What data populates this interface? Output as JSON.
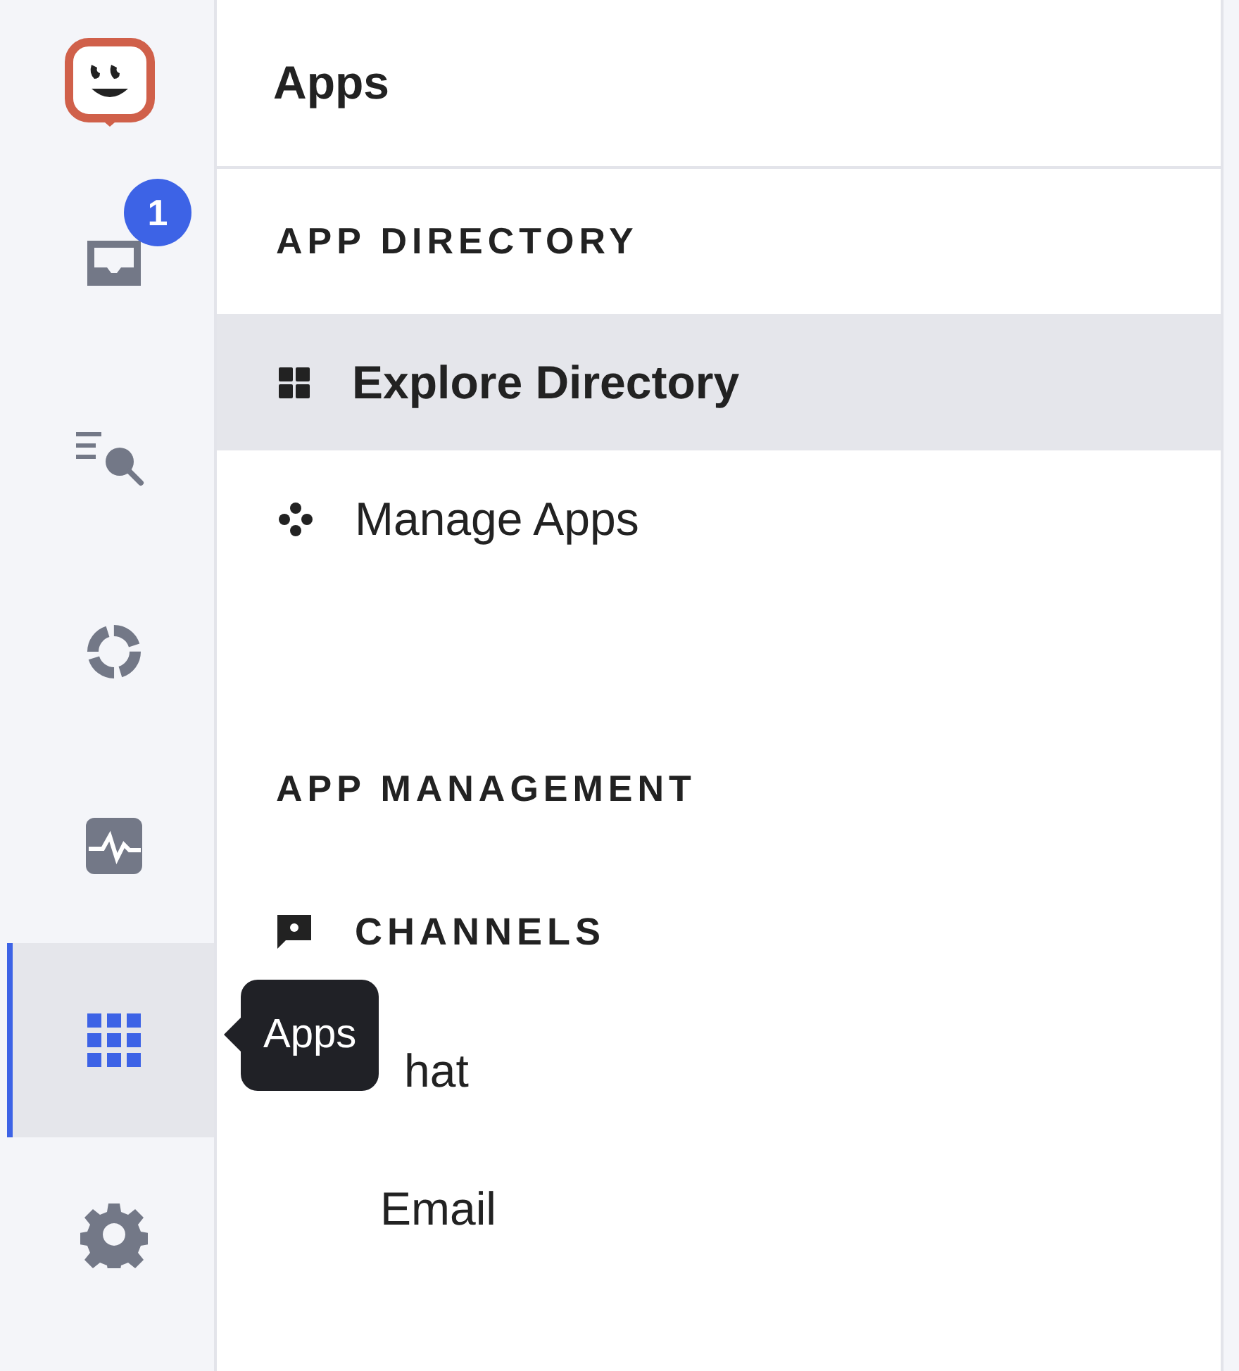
{
  "rail": {
    "items": [
      {
        "kind": "logo"
      },
      {
        "kind": "inbox",
        "selected": false,
        "badge": "1"
      },
      {
        "kind": "search",
        "selected": false
      },
      {
        "kind": "ring",
        "selected": false
      },
      {
        "kind": "pulse",
        "selected": false
      },
      {
        "kind": "apps",
        "selected": true,
        "tooltip": "Apps"
      },
      {
        "kind": "settings",
        "selected": false
      }
    ]
  },
  "panel": {
    "title": "Apps",
    "rows": [
      {
        "kind": "section",
        "label": "APP DIRECTORY"
      },
      {
        "kind": "item",
        "label": "Explore Directory",
        "selected": true
      },
      {
        "kind": "item",
        "label": "Manage Apps",
        "selected": false
      },
      {
        "kind": "section",
        "label": "APP MANAGEMENT"
      },
      {
        "kind": "group",
        "label": "CHANNELS"
      },
      {
        "kind": "subitem",
        "label": "hat",
        "selected": false
      },
      {
        "kind": "subitem",
        "label": "Email",
        "selected": false
      }
    ]
  }
}
